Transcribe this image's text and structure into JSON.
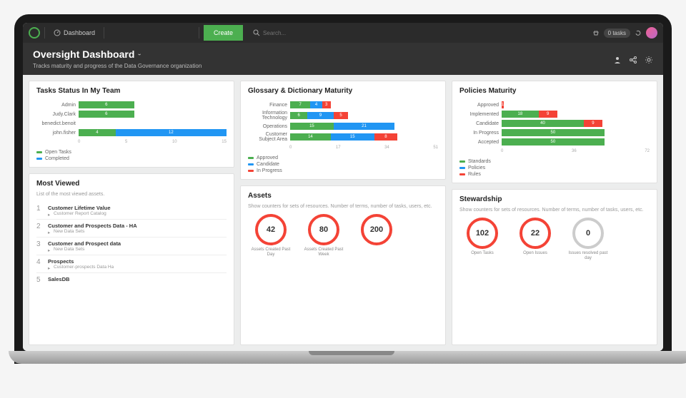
{
  "nav": {
    "dashboard": "Dashboard",
    "create": "Create",
    "search_placeholder": "Search...",
    "tasks_pill": "0 tasks"
  },
  "title": {
    "heading": "Oversight Dashboard",
    "subtitle": "Tracks maturity and progress of the Data Governance organization"
  },
  "tasks_status": {
    "title": "Tasks Status In My Team",
    "rows": [
      {
        "label": "Admin",
        "open": 6,
        "completed": 0
      },
      {
        "label": "Judy.Clark",
        "open": 6,
        "completed": 0
      },
      {
        "label": "benedict.benoit",
        "open": 0,
        "completed": 0
      },
      {
        "label": "john.fisher",
        "open": 4,
        "completed": 12
      }
    ],
    "axis": [
      "0",
      "5",
      "10",
      "15"
    ],
    "legend": {
      "open": "Open Tasks",
      "completed": "Completed"
    }
  },
  "glossary": {
    "title": "Glossary & Dictionary Maturity",
    "rows": [
      {
        "label": "Finance",
        "approved": 7,
        "candidate": 4,
        "inprogress": 3
      },
      {
        "label": "Information Technology",
        "approved": 6,
        "candidate": 9,
        "inprogress": 5
      },
      {
        "label": "Operations",
        "approved": 15,
        "candidate": 21,
        "inprogress": 0
      },
      {
        "label": "Customer Subject Area",
        "approved": 14,
        "candidate": 15,
        "inprogress": 8
      }
    ],
    "axis": [
      "0",
      "17",
      "34",
      "51"
    ],
    "legend": {
      "a": "Approved",
      "b": "Candidate",
      "c": "In Progress"
    }
  },
  "policies": {
    "title": "Policies Maturity",
    "rows": [
      {
        "label": "Approved",
        "green": 0,
        "blue": 0,
        "red": 1
      },
      {
        "label": "Implemented",
        "green": 18,
        "blue": 0,
        "red": 9
      },
      {
        "label": "Candidate",
        "green": 40,
        "blue": 0,
        "red": 9
      },
      {
        "label": "In Progress",
        "green": 50,
        "blue": 0,
        "red": 0
      },
      {
        "label": "Accepted",
        "green": 50,
        "blue": 0,
        "red": 0
      }
    ],
    "axis": [
      "0",
      "36",
      "72"
    ],
    "legend": {
      "a": "Standards",
      "b": "Policies",
      "c": "Rules"
    }
  },
  "most_viewed": {
    "title": "Most Viewed",
    "desc": "List of the most viewed assets.",
    "items": [
      {
        "rank": "1",
        "primary": "Customer Lifetime Value",
        "secondary": "Customer Report Catalog"
      },
      {
        "rank": "2",
        "primary": "Customer and Prospects Data - HA",
        "secondary": "New Data Sets"
      },
      {
        "rank": "3",
        "primary": "Customer and Prospect data",
        "secondary": "New Data Sets"
      },
      {
        "rank": "4",
        "primary": "Prospects",
        "secondary": "Customer-prospects Data Ha"
      },
      {
        "rank": "5",
        "primary": "SalesDB",
        "secondary": ""
      }
    ]
  },
  "assets": {
    "title": "Assets",
    "desc": "Show counters for sets of resources. Number of terms, number of tasks, users, etc.",
    "items": [
      {
        "value": "42",
        "label": "Assets Created Past Day"
      },
      {
        "value": "80",
        "label": "Assets Created Past Week"
      },
      {
        "value": "200",
        "label": ""
      }
    ]
  },
  "stewardship": {
    "title": "Stewardship",
    "desc": "Show counters for sets of resources. Number of terms, number of tasks, users, etc.",
    "items": [
      {
        "value": "102",
        "label": "Open Tasks",
        "gray": false
      },
      {
        "value": "22",
        "label": "Open Issues",
        "gray": false
      },
      {
        "value": "0",
        "label": "Issues resolved past day",
        "gray": true
      }
    ]
  },
  "chart_data": [
    {
      "type": "bar",
      "title": "Tasks Status In My Team",
      "orientation": "horizontal",
      "categories": [
        "Admin",
        "Judy.Clark",
        "benedict.benoit",
        "john.fisher"
      ],
      "series": [
        {
          "name": "Open Tasks",
          "values": [
            6,
            6,
            0,
            4
          ],
          "color": "#4caf50"
        },
        {
          "name": "Completed",
          "values": [
            0,
            0,
            0,
            12
          ],
          "color": "#2196f3"
        }
      ],
      "xlim": [
        0,
        15
      ]
    },
    {
      "type": "bar",
      "title": "Glossary & Dictionary Maturity",
      "orientation": "horizontal",
      "stacked": true,
      "categories": [
        "Finance",
        "Information Technology",
        "Operations",
        "Customer Subject Area"
      ],
      "series": [
        {
          "name": "Approved",
          "values": [
            7,
            6,
            15,
            14
          ],
          "color": "#4caf50"
        },
        {
          "name": "Candidate",
          "values": [
            4,
            9,
            21,
            15
          ],
          "color": "#2196f3"
        },
        {
          "name": "In Progress",
          "values": [
            3,
            5,
            0,
            8
          ],
          "color": "#f44336"
        }
      ],
      "xlim": [
        0,
        51
      ]
    },
    {
      "type": "bar",
      "title": "Policies Maturity",
      "orientation": "horizontal",
      "stacked": true,
      "categories": [
        "Approved",
        "Implemented",
        "Candidate",
        "In Progress",
        "Accepted"
      ],
      "series": [
        {
          "name": "Standards",
          "values": [
            0,
            18,
            40,
            50,
            50
          ],
          "color": "#4caf50"
        },
        {
          "name": "Policies",
          "values": [
            0,
            0,
            0,
            0,
            0
          ],
          "color": "#2196f3"
        },
        {
          "name": "Rules",
          "values": [
            1,
            9,
            9,
            0,
            0
          ],
          "color": "#f44336"
        }
      ],
      "xlim": [
        0,
        72
      ]
    }
  ]
}
